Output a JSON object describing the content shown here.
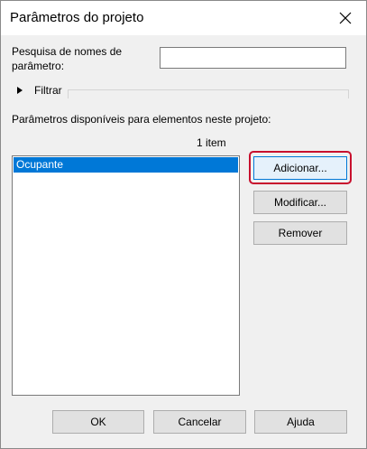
{
  "window": {
    "title": "Parâmetros do projeto"
  },
  "search": {
    "label_line1": "Pesquisa de nomes de",
    "label_line2": "parâmetro:",
    "value": ""
  },
  "filter": {
    "label": "Filtrar"
  },
  "parameters": {
    "header": "Parâmetros disponíveis para elementos neste projeto:",
    "count": "1 item",
    "items": [
      "Ocupante"
    ]
  },
  "actions": {
    "add": "Adicionar...",
    "modify": "Modificar...",
    "remove": "Remover"
  },
  "footer": {
    "ok": "OK",
    "cancel": "Cancelar",
    "help": "Ajuda"
  },
  "colors": {
    "selection": "#0078d7",
    "highlight": "#c8102e"
  }
}
